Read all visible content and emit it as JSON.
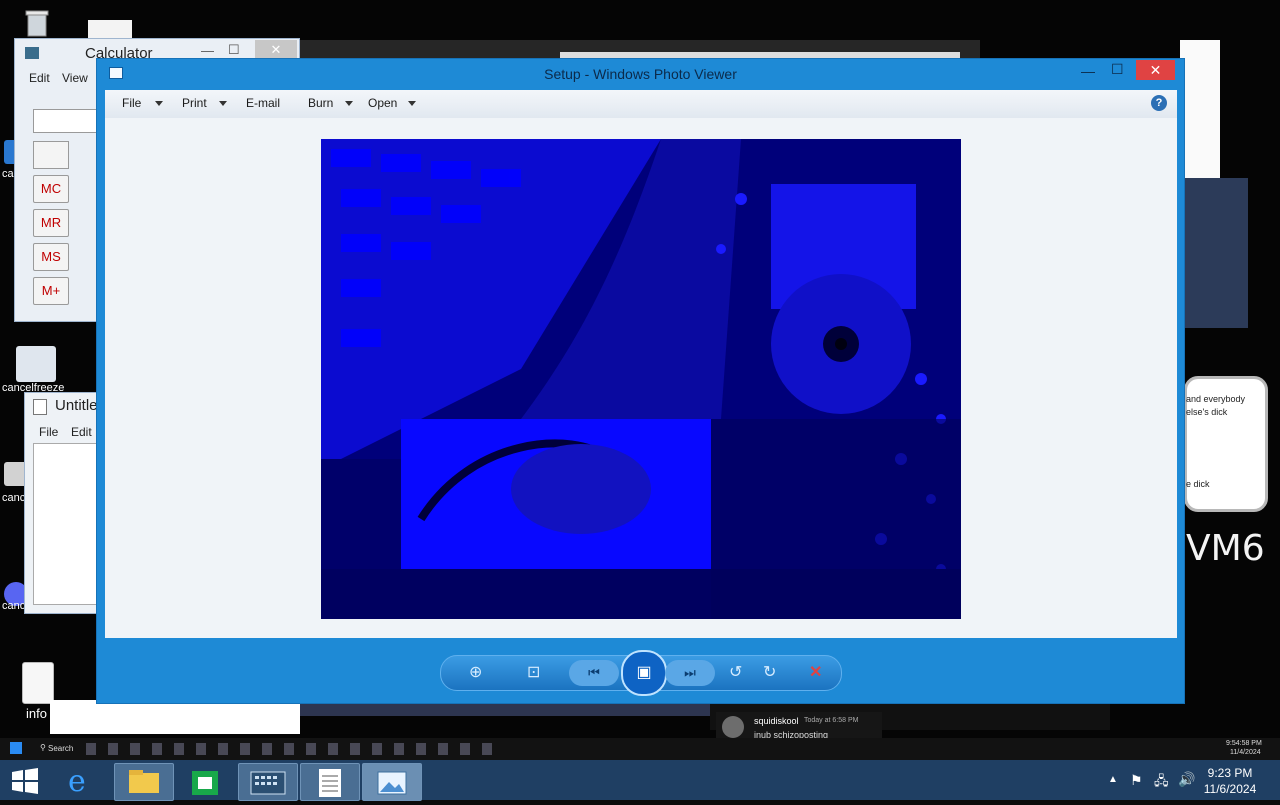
{
  "calculator": {
    "title": "Calculator",
    "menu": [
      "Edit",
      "View"
    ],
    "memory_buttons": [
      "MC",
      "MR",
      "MS",
      "M+"
    ]
  },
  "notepad": {
    "title": "Untitle",
    "menu": [
      "File",
      "Edit"
    ]
  },
  "desktop_icons": [
    {
      "label": "canc",
      "icon": "app-icon"
    },
    {
      "label": "cancelfreeze",
      "icon": "gear-icon"
    },
    {
      "label": "canc",
      "icon": "app-icon"
    },
    {
      "label": "canc",
      "icon": "discord-icon"
    },
    {
      "label": "info",
      "icon": "file-icon"
    }
  ],
  "photo_viewer": {
    "title": "Setup - Windows Photo Viewer",
    "toolbar": {
      "file": "File",
      "print": "Print",
      "email": "E-mail",
      "burn": "Burn",
      "open": "Open"
    },
    "image_description_colors": {
      "primary": "#0000ff",
      "dark": "#00003a"
    }
  },
  "background_windows": {
    "chat_text_1": "and everybody",
    "chat_text_2": "else's dick",
    "chat_text_3": "e dick",
    "handwriting": "VM6",
    "notification_user": "squidiskool",
    "notification_time": "Today at 6:58 PM",
    "notification_text": "inub schizoposting"
  },
  "mini_taskbar": {
    "search": "Search",
    "time": "9:54:58 PM",
    "date": "11/4/2024"
  },
  "taskbar": {
    "items": [
      "start-button",
      "internet-explorer",
      "file-explorer",
      "store",
      "calculator",
      "notepad",
      "photo-viewer"
    ],
    "time": "9:23 PM",
    "date": "11/6/2024"
  },
  "colors": {
    "taskbar": "#1f3f63",
    "window_accent": "#1e8ad6",
    "close_red": "#e04343"
  }
}
